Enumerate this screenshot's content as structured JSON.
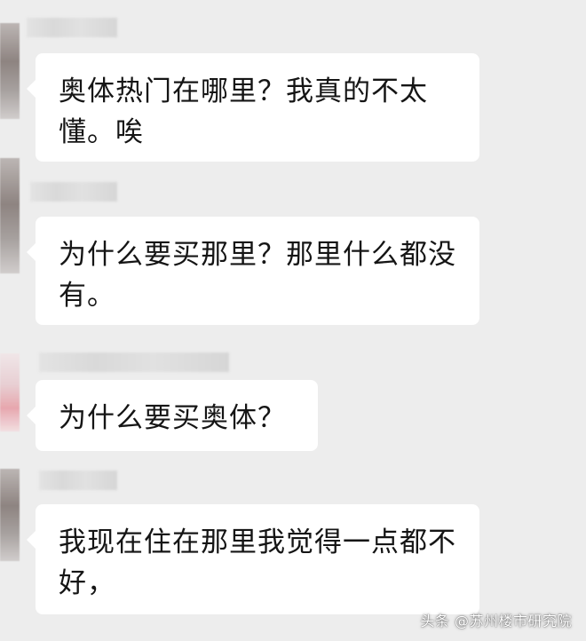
{
  "chat": {
    "messages": [
      {
        "text": "奥体热门在哪里？我真的不太懂。唉"
      },
      {
        "text": "为什么要买那里？那里什么都没有。"
      },
      {
        "text": "为什么要买奥体？"
      },
      {
        "text": "我现在住在那里我觉得一点都不好，"
      }
    ]
  },
  "watermark": {
    "text": "头条 @苏州楼市研究院"
  },
  "colors": {
    "background": "#ededed",
    "bubble": "#ffffff",
    "text": "#151515"
  }
}
